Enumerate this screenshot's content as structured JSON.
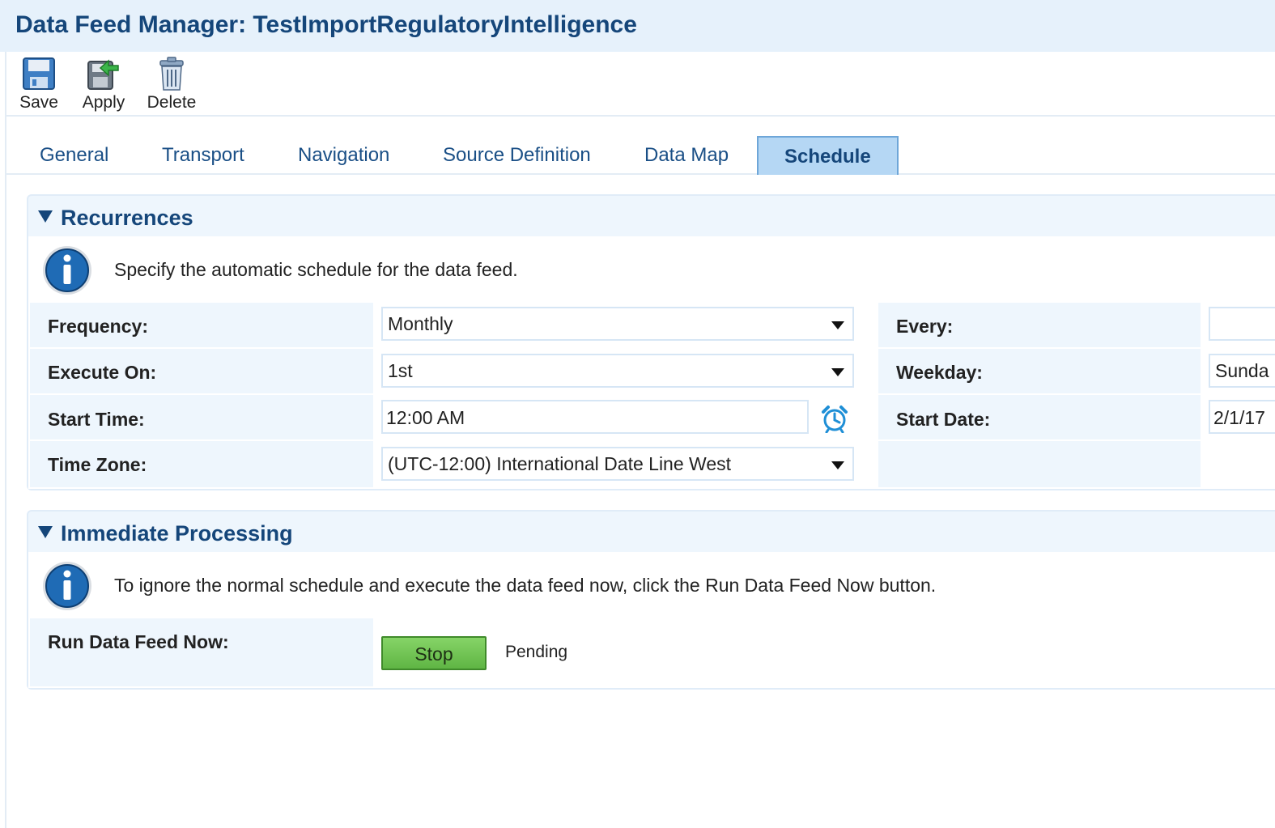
{
  "window": {
    "title": "Data Feed Manager: TestImportRegulatoryIntelligence"
  },
  "toolbar": {
    "save_label": "Save",
    "apply_label": "Apply",
    "delete_label": "Delete"
  },
  "tabs": {
    "items": [
      "General",
      "Transport",
      "Navigation",
      "Source Definition",
      "Data Map",
      "Schedule"
    ],
    "active": "Schedule"
  },
  "recurrences": {
    "title": "Recurrences",
    "info": "Specify the automatic schedule for the data feed.",
    "frequency_label": "Frequency:",
    "frequency_value": "Monthly",
    "execute_on_label": "Execute On:",
    "execute_on_value": "1st",
    "start_time_label": "Start Time:",
    "start_time_value": "12:00 AM",
    "time_zone_label": "Time Zone:",
    "time_zone_value": "(UTC-12:00) International Date Line West",
    "every_label": "Every:",
    "every_value": "",
    "weekday_label": "Weekday:",
    "weekday_value": "Sunda",
    "start_date_label": "Start Date:",
    "start_date_value": "2/1/17"
  },
  "immediate": {
    "title": "Immediate Processing",
    "info": "To ignore the normal schedule and execute the data feed now, click the Run Data Feed Now button.",
    "run_label": "Run Data Feed Now:",
    "stop_label": "Stop",
    "status": "Pending"
  },
  "colors": {
    "title_bar": "#e6f1fb",
    "title_text": "#15467a",
    "active_tab": "#b5d7f4",
    "stop_button": "#6cc24f"
  },
  "icons": {
    "save": "floppy-disk-icon",
    "apply": "apply-arrow-icon",
    "delete": "trash-can-icon",
    "info": "info-icon",
    "clock": "alarm-clock-icon"
  }
}
